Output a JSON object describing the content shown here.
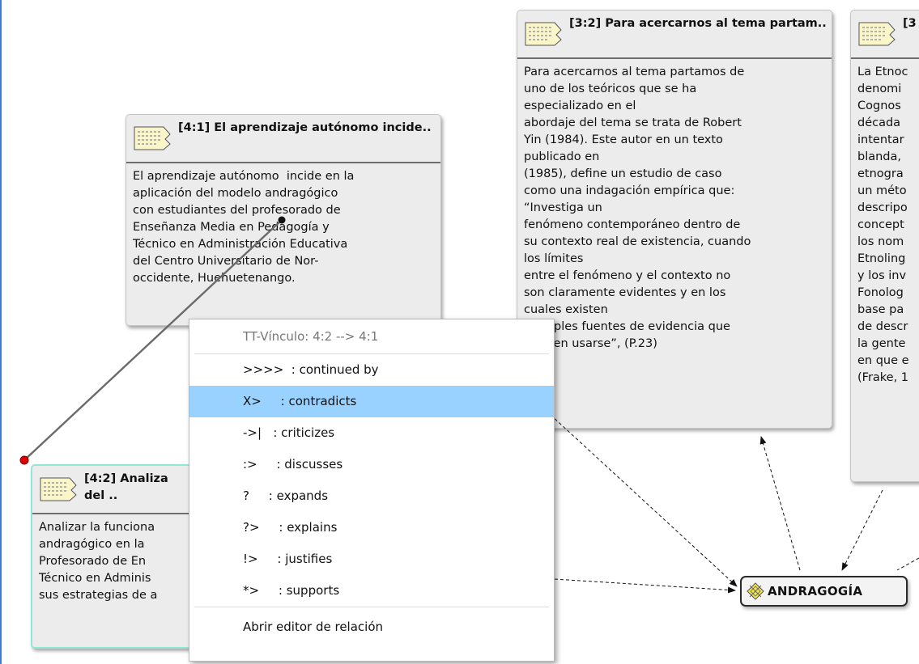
{
  "quotes": {
    "q41": {
      "title": "[4:1] El aprendizaje autónomo incide..",
      "body": "El aprendizaje autónomo  incide en la\naplicación del modelo andragógico\ncon estudiantes del profesorado de\nEnseñanza Media en Pedagogía y\nTécnico en Administración Educativa\ndel Centro Universitario de Nor-\noccidente, Huehuetenango."
    },
    "q32": {
      "title": "[3:2] Para acercarnos al tema partam..",
      "body": "Para acercarnos al tema partamos de\nuno de los teóricos que se ha\nespecializado en el\nabordaje del tema se trata de Robert\nYin (1984). Este autor en un texto\npublicado en\n(1985), define un estudio de caso\ncomo una indagación empírica que:\n“Investiga un\nfenómeno contemporáneo dentro de\nsu contexto real de existencia, cuando\nlos límites\nentre el fenómeno y el contexto no\nson claramente evidentes y en los\ncuales existen\nmúltiples fuentes de evidencia que\npueden usarse”, (P.23)"
    },
    "q3x": {
      "title": "[3",
      "body": "La Etnoc\ndenomi\nCognos\ndécada \nintentar\nblanda, \netnogra\nun méto\ndescripo\nconcept\nlos nom\nEtnoling\ny los inv\nFonolog\nbase pa\nde descr\nla gente\nen que e\n(Frake, 1"
    },
    "q42": {
      "title": "[4:2] Analiza\ndel ..",
      "body": "Analizar la funciona\nandragógico en la \nProfesorado de En\nTécnico en Adminis\nsus estrategias de a"
    }
  },
  "code_node": {
    "label": "ANDRAGOGÍA",
    "icon": "code-diamond-icon"
  },
  "context_menu": {
    "header": "TT-Vínculo: 4:2 --> 4:1",
    "items": [
      ">>>>  : continued by",
      "X>     : contradicts",
      "->|   : criticizes",
      ":>     : discusses",
      "?     : expands",
      "?>     : explains",
      "!>     : justifies",
      "*>     : supports"
    ],
    "footer": "Abrir editor de relación",
    "hovered_index": 1
  },
  "colors": {
    "menu_hover": "#99d1ff",
    "link_handle": "#e00000",
    "selection_border": "#8fe9d5",
    "frame": "#3a7bd5"
  }
}
